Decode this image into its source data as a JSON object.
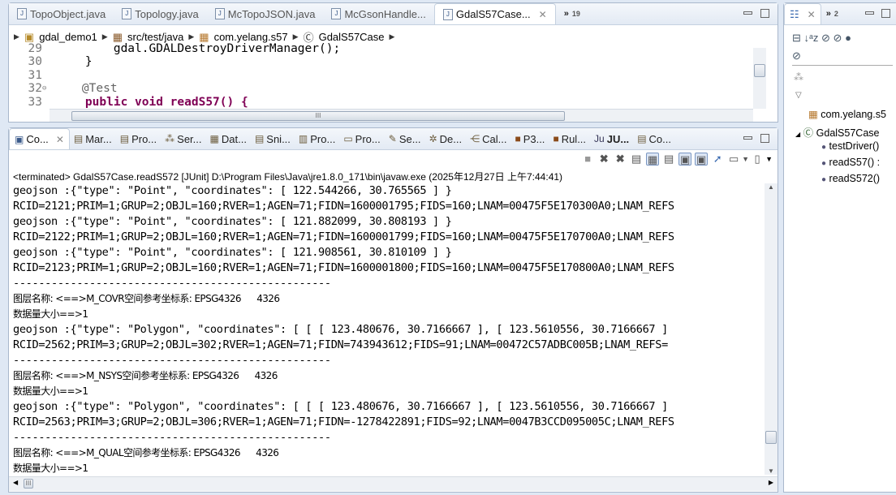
{
  "editor": {
    "tabs": [
      {
        "label": "TopoObject.java"
      },
      {
        "label": "Topology.java"
      },
      {
        "label": "McTopoJSON.java"
      },
      {
        "label": "McGsonHandle..."
      },
      {
        "label": "GdalS57Case...",
        "active": true
      }
    ],
    "overflow_count": "19",
    "breadcrumb": [
      "gdal_demo1",
      "src/test/java",
      "com.yelang.s57",
      "GdalS57Case"
    ],
    "code_lines": [
      {
        "num": "29",
        "code": "        gdal.GDALDestroyDriverManager();"
      },
      {
        "num": "30",
        "code": "    }"
      },
      {
        "num": "31",
        "code": ""
      },
      {
        "num": "32",
        "code": "    @Test"
      },
      {
        "num": "33",
        "code": "    public void readS57() {"
      }
    ],
    "hscroll_thumb": "III"
  },
  "console": {
    "tabs": [
      {
        "label": "Co...",
        "icon": "console-icon",
        "active": true
      },
      {
        "label": "Mar...",
        "icon": "markers-icon"
      },
      {
        "label": "Pro...",
        "icon": "properties-icon"
      },
      {
        "label": "Ser...",
        "icon": "servers-icon"
      },
      {
        "label": "Dat...",
        "icon": "data-source-icon"
      },
      {
        "label": "Sni...",
        "icon": "snippets-icon"
      },
      {
        "label": "Pro...",
        "icon": "problems-icon"
      },
      {
        "label": "Pro...",
        "icon": "progress-icon"
      },
      {
        "label": "Se...",
        "icon": "search-icon"
      },
      {
        "label": "De...",
        "icon": "debug-icon"
      },
      {
        "label": "Cal...",
        "icon": "call-hierarchy-icon"
      },
      {
        "label": "P3...",
        "icon": "p3-icon"
      },
      {
        "label": "Rul...",
        "icon": "rules-icon"
      },
      {
        "label": "JU...",
        "icon": "junit-icon"
      },
      {
        "label": "Co...",
        "icon": "coverage-icon"
      }
    ],
    "status": "<terminated> GdalS57Case.readS572 [JUnit] D:\\Program Files\\Java\\jre1.8.0_171\\bin\\javaw.exe (2025年12月27日 上午7:44:41)",
    "lines": [
      {
        "text": "geojson :{\"type\": \"Point\", \"coordinates\": [ 122.544266, 30.765565 ] }"
      },
      {
        "text": "RCID=2121;PRIM=1;GRUP=2;OBJL=160;RVER=1;AGEN=71;FIDN=1600001795;FIDS=160;LNAM=00475F5E170300A0;LNAM_REFS"
      },
      {
        "text": "geojson :{\"type\": \"Point\", \"coordinates\": [ 121.882099, 30.808193 ] }"
      },
      {
        "text": "RCID=2122;PRIM=1;GRUP=2;OBJL=160;RVER=1;AGEN=71;FIDN=1600001799;FIDS=160;LNAM=00475F5E170700A0;LNAM_REFS"
      },
      {
        "text": "geojson :{\"type\": \"Point\", \"coordinates\": [ 121.908561, 30.810109 ] }"
      },
      {
        "text": "RCID=2123;PRIM=1;GRUP=2;OBJL=160;RVER=1;AGEN=71;FIDN=1600001800;FIDS=160;LNAM=00475F5E170800A0;LNAM_REFS"
      },
      {
        "text": "--------------------------------------------------"
      },
      {
        "text": "图层名称: <==>M_COVR空间参考坐标系: EPSG4326      4326",
        "cn": true
      },
      {
        "text": "数据量大小==>1",
        "cn": true
      },
      {
        "text": "geojson :{\"type\": \"Polygon\", \"coordinates\": [ [ [ 123.480676, 30.7166667 ], [ 123.5610556, 30.7166667 ]"
      },
      {
        "text": "RCID=2562;PRIM=3;GRUP=2;OBJL=302;RVER=1;AGEN=71;FIDN=743943612;FIDS=91;LNAM=00472C57ADBC005B;LNAM_REFS="
      },
      {
        "text": "--------------------------------------------------"
      },
      {
        "text": "图层名称: <==>M_NSYS空间参考坐标系: EPSG4326      4326",
        "cn": true
      },
      {
        "text": "数据量大小==>1",
        "cn": true
      },
      {
        "text": "geojson :{\"type\": \"Polygon\", \"coordinates\": [ [ [ 123.480676, 30.7166667 ], [ 123.5610556, 30.7166667 ]"
      },
      {
        "text": "RCID=2563;PRIM=3;GRUP=2;OBJL=306;RVER=1;AGEN=71;FIDN=-1278422891;FIDS=92;LNAM=0047B3CCD095005C;LNAM_REFS"
      },
      {
        "text": "--------------------------------------------------"
      },
      {
        "text": "图层名称: <==>M_QUAL空间参考坐标系: EPSG4326      4326",
        "cn": true
      },
      {
        "text": "数据量大小==>1",
        "cn": true
      }
    ],
    "hscroll_thumb": "III"
  },
  "outline": {
    "overflow_count": "2",
    "items": [
      {
        "label": "com.yelang.s5",
        "icon": "package-icon"
      },
      {
        "label": "GdalS57Case",
        "icon": "class-icon"
      },
      {
        "label": "testDriver()",
        "icon": "method-icon"
      },
      {
        "label": "readS57() :",
        "icon": "method-icon"
      },
      {
        "label": "readS572()",
        "icon": "method-icon"
      }
    ]
  }
}
